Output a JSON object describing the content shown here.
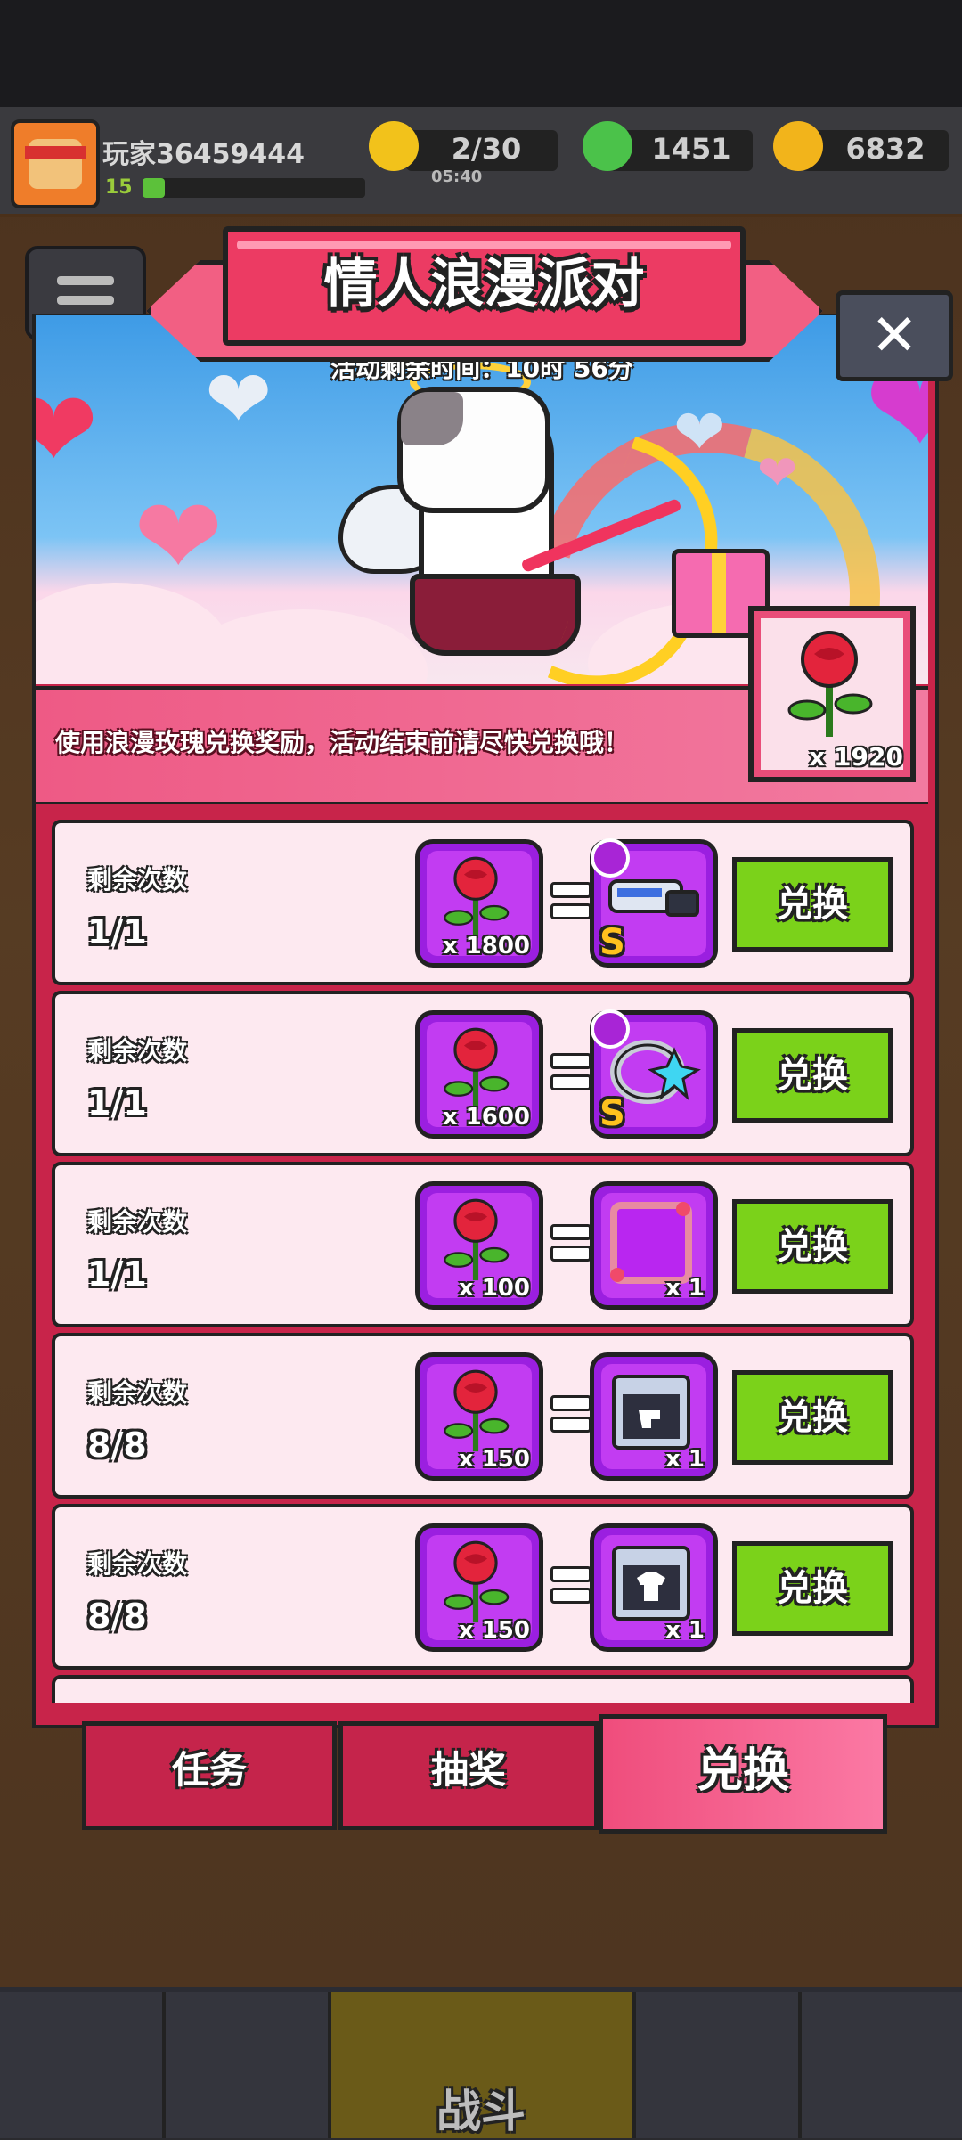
{
  "player": {
    "name": "玩家36459444",
    "level": "15",
    "xp_fraction": 0.1
  },
  "resources": {
    "energy": "2/30",
    "energy_timer": "05:40",
    "gems": "1451",
    "coins": "6832"
  },
  "event": {
    "title": "情人浪漫派对",
    "time_left": "活动剩余时间：10时 56分",
    "info": "使用浪漫玫瑰兑换奖励，活动结束前请尽快兑换哦！",
    "rose_total": "x 1920"
  },
  "exchange_rows": [
    {
      "label": "剩余次数",
      "count": "1/1",
      "cost": "x 1800",
      "reward": "weapon-gun",
      "reward_qty": "",
      "rank": "S",
      "button": "兑换"
    },
    {
      "label": "剩余次数",
      "count": "1/1",
      "cost": "x 1600",
      "reward": "ring",
      "reward_qty": "",
      "rank": "S",
      "button": "兑换"
    },
    {
      "label": "剩余次数",
      "count": "1/1",
      "cost": "x 100",
      "reward": "avatar-frame",
      "reward_qty": "x 1",
      "rank": "",
      "button": "兑换"
    },
    {
      "label": "剩余次数",
      "count": "8/8",
      "cost": "x 150",
      "reward": "weapon-chest",
      "reward_qty": "x 1",
      "rank": "",
      "button": "兑换"
    },
    {
      "label": "剩余次数",
      "count": "8/8",
      "cost": "x 150",
      "reward": "armor-chest",
      "reward_qty": "x 1",
      "rank": "",
      "button": "兑换"
    }
  ],
  "tabs": [
    {
      "label": "任务",
      "active": false
    },
    {
      "label": "抽奖",
      "active": false
    },
    {
      "label": "兑换",
      "active": true
    }
  ],
  "bottom_nav": {
    "battle_label": "战斗"
  },
  "colors": {
    "accent": "#ec3b63",
    "exchange_button": "#7bd21a",
    "slot": "#9b1fe0"
  }
}
